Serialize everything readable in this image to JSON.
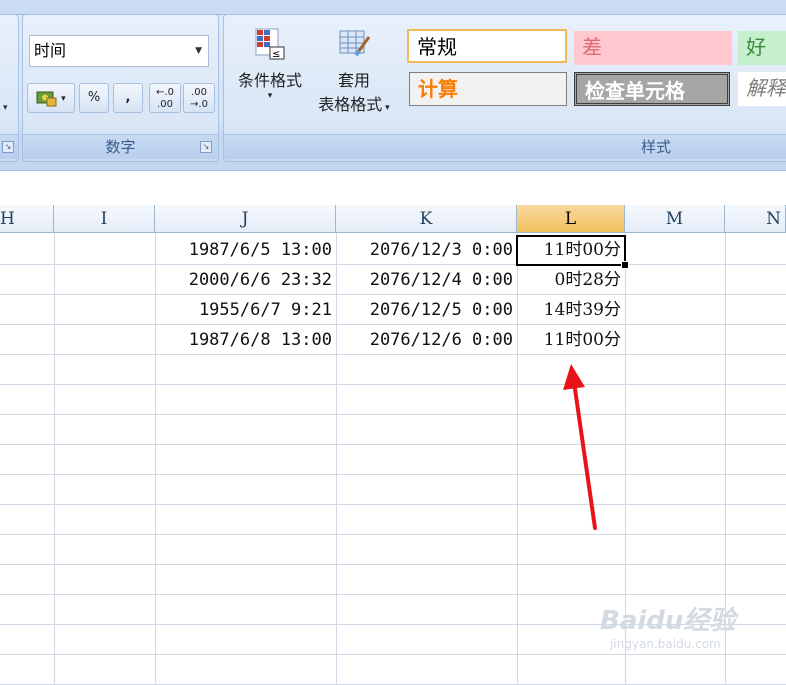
{
  "ribbon": {
    "number_group": {
      "format_value": "时间",
      "label": "数字",
      "percent": "%",
      "comma": ",",
      "increase_decimal": "←.0 .00",
      "decrease_decimal": ".00 →.0"
    },
    "styles_group": {
      "conditional_format": "条件格式",
      "table_format_line1": "套用",
      "table_format_line2": "表格格式",
      "label": "样式",
      "styles": {
        "normal": "常规",
        "bad": "差",
        "good": "好",
        "calculation": "计算",
        "check_cell": "检查单元格",
        "explanatory": "解释"
      }
    }
  },
  "columns": [
    "H",
    "I",
    "J",
    "K",
    "L",
    "M",
    "N"
  ],
  "selected_column": "L",
  "rows": [
    {
      "J": "1987/6/5 13:00",
      "K": "2076/12/3 0:00",
      "L": "11时00分"
    },
    {
      "J": "2000/6/6 23:32",
      "K": "2076/12/4 0:00",
      "L": "0时28分"
    },
    {
      "J": "1955/6/7 9:21",
      "K": "2076/12/5 0:00",
      "L": "14时39分"
    },
    {
      "J": "1987/6/8 13:00",
      "K": "2076/12/6 0:00",
      "L": "11时00分"
    }
  ],
  "watermark": {
    "main": "Baidu经验",
    "sub": "jingyan.baidu.com"
  },
  "colors": {
    "accent_arrow": "#e8141b",
    "selected_header": "#f1c15f",
    "check_cell_bg": "#a5a5a5"
  }
}
